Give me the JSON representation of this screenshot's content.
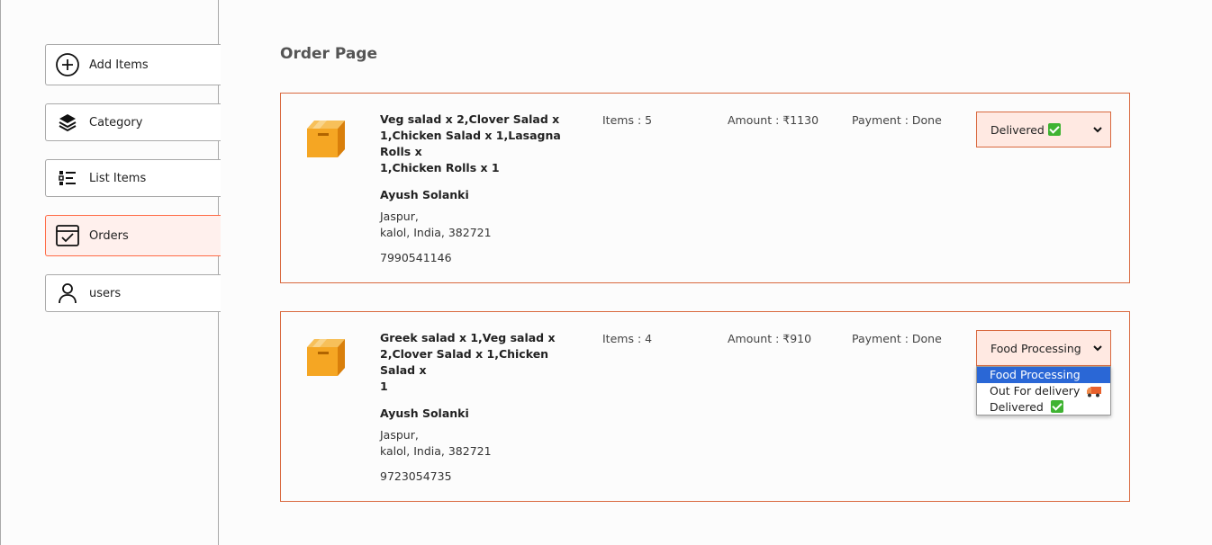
{
  "sidebar": {
    "items": [
      {
        "label": "Add Items",
        "icon": "plus-circle-icon"
      },
      {
        "label": "Category",
        "icon": "layers-icon"
      },
      {
        "label": "List Items",
        "icon": "list-icon"
      },
      {
        "label": "Orders",
        "icon": "orders-check-icon",
        "active": true
      },
      {
        "label": "users",
        "icon": "user-icon"
      }
    ]
  },
  "page": {
    "title": "Order Page"
  },
  "orders": [
    {
      "items_line1": "Veg salad x 2,Clover Salad x",
      "items_line2": "1,Chicken Salad x 1,Lasagna Rolls x",
      "items_line3": "1,Chicken Rolls x 1",
      "name": "Ayush Solanki",
      "address1": "Jaspur,",
      "address2": "kalol, India, 382721",
      "phone": "7990541146",
      "count": "Items : 5",
      "amount": "Amount : ₹1130",
      "payment": "Payment : Done",
      "status": "Delivered"
    },
    {
      "items_line1": "Greek salad x 1,Veg salad x",
      "items_line2": "2,Clover Salad x 1,Chicken Salad x",
      "items_line3": "1",
      "name": "Ayush Solanki",
      "address1": "Jaspur,",
      "address2": "kalol, India, 382721",
      "phone": "9723054735",
      "count": "Items : 4",
      "amount": "Amount : ₹910",
      "payment": "Payment : Done",
      "status": "Food Processing"
    }
  ],
  "status_options": [
    "Food Processing",
    "Out For delivery",
    "Delivered"
  ],
  "colors": {
    "accent": "#d9693f",
    "selected": "#2a67d6",
    "box": "#f5a623"
  }
}
